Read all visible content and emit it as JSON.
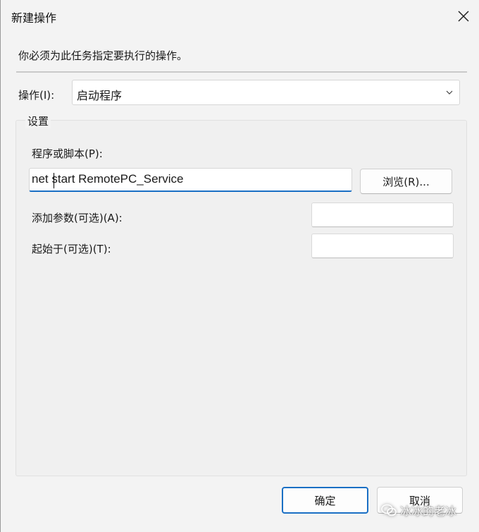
{
  "window": {
    "title": "新建操作"
  },
  "description": "你必须为此任务指定要执行的操作。",
  "action": {
    "label": "操作(I):",
    "selected": "启动程序"
  },
  "settings": {
    "group_label": "设置",
    "program_label": "程序或脚本(P):",
    "program_value": "net start RemotePC_Service",
    "browse_label": "浏览(R)...",
    "args_label": "添加参数(可选)(A):",
    "args_value": "",
    "start_in_label": "起始于(可选)(T):",
    "start_in_value": ""
  },
  "buttons": {
    "ok": "确定",
    "cancel": "取消"
  },
  "watermark": {
    "text": "冰冰的老冰"
  },
  "colors": {
    "accent": "#1a6fc4",
    "background": "#f3f3f3"
  }
}
